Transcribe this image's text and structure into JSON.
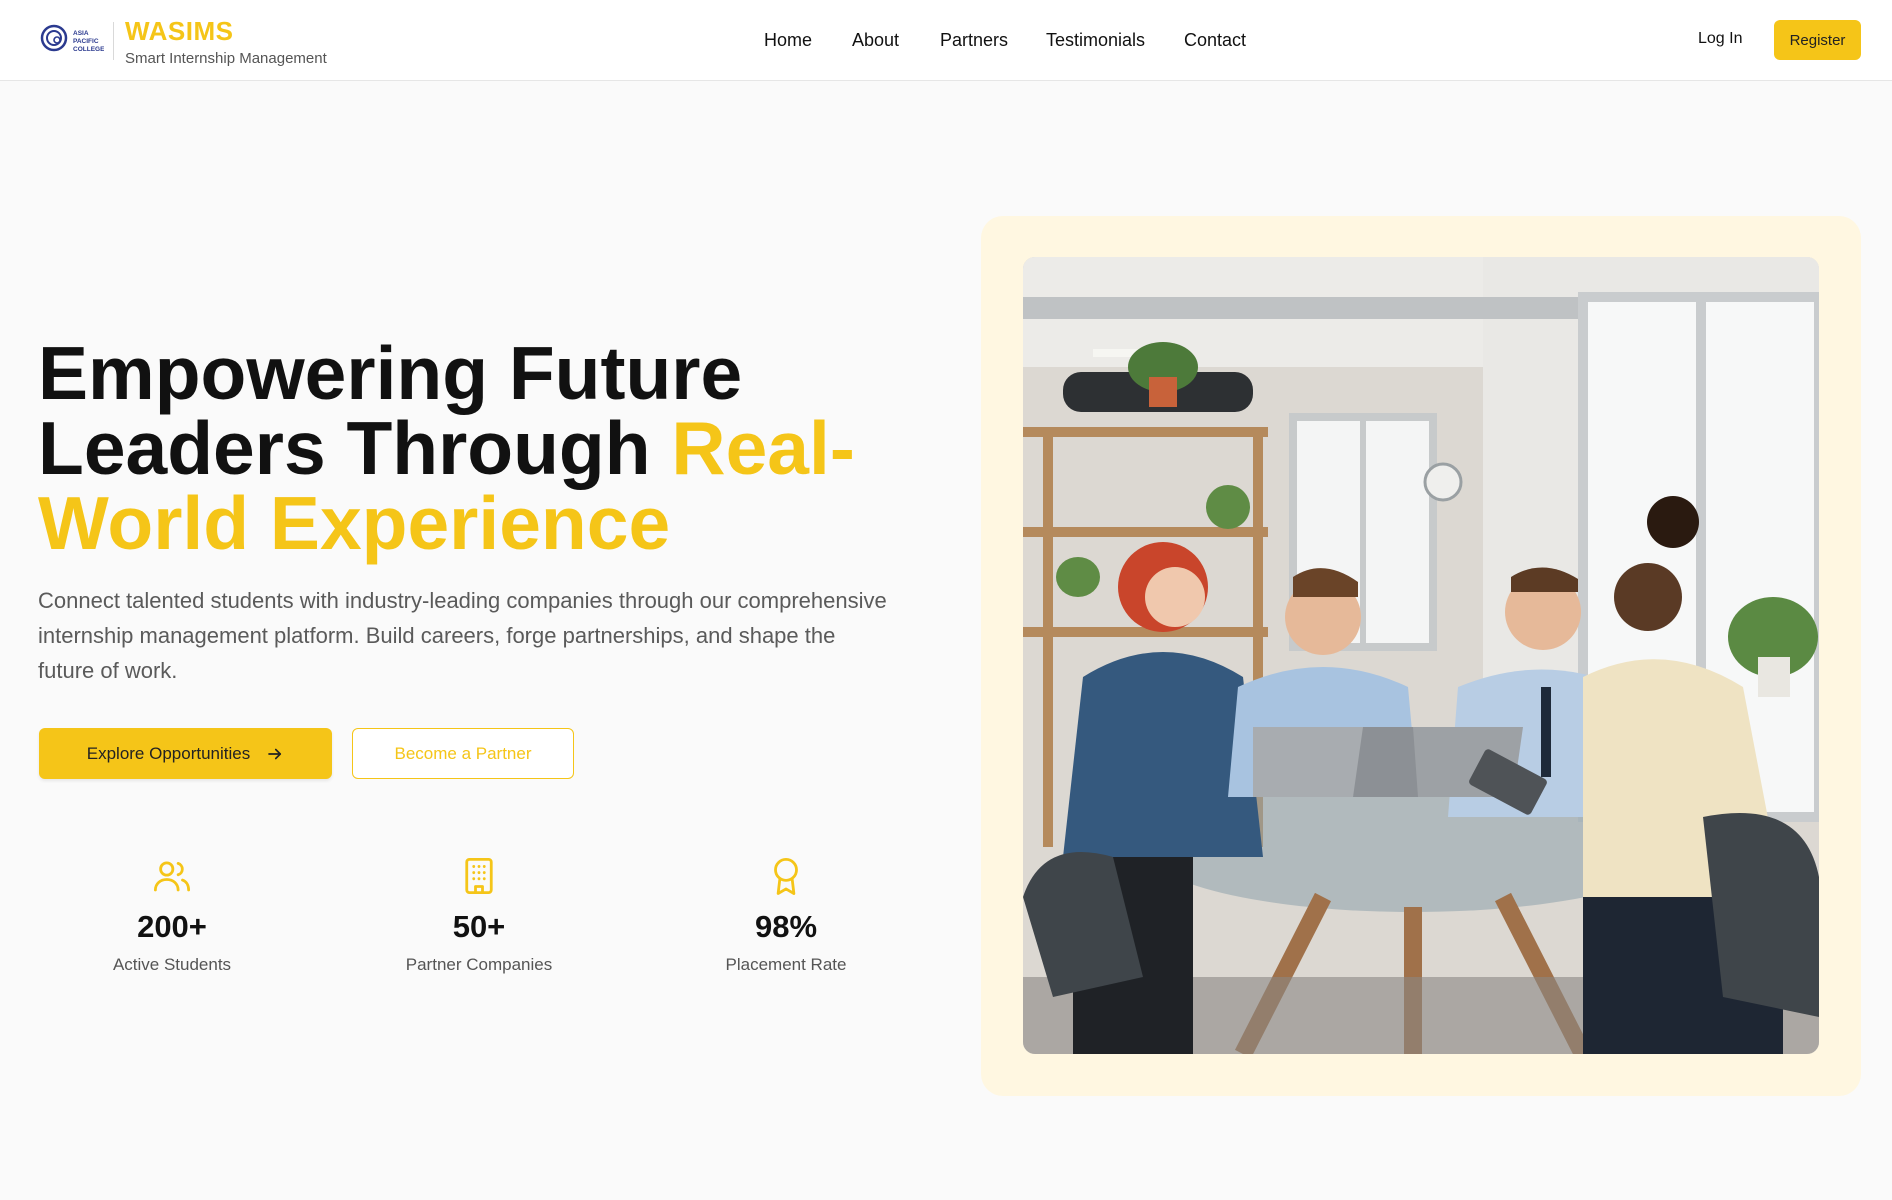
{
  "brand": {
    "logo_name": "asia-pacific-college-logo",
    "logo_text": "ASIA PACIFIC COLLEGE",
    "title": "WASIMS",
    "subtitle": "Smart Internship Management"
  },
  "nav": {
    "items": [
      "Home",
      "About",
      "Partners",
      "Testimonials",
      "Contact"
    ],
    "login": "Log In",
    "register": "Register"
  },
  "hero": {
    "headline_part1": "Empowering Future",
    "headline_part2": "Leaders Through ",
    "headline_highlight1": "Real-",
    "headline_highlight2": "World Experience",
    "description": "Connect talented students with industry-leading companies through our comprehensive internship management platform. Build careers, forge partnerships, and shape the future of work.",
    "primary_button": "Explore Opportunities",
    "secondary_button": "Become a Partner"
  },
  "stats": [
    {
      "icon": "users-icon",
      "value": "200+",
      "label": "Active Students"
    },
    {
      "icon": "building-icon",
      "value": "50+",
      "label": "Partner Companies"
    },
    {
      "icon": "award-icon",
      "value": "98%",
      "label": "Placement Rate"
    }
  ],
  "colors": {
    "accent": "#f5c518",
    "card_bg": "#fff7e1",
    "text": "#111111",
    "muted": "#5a5a5a"
  }
}
